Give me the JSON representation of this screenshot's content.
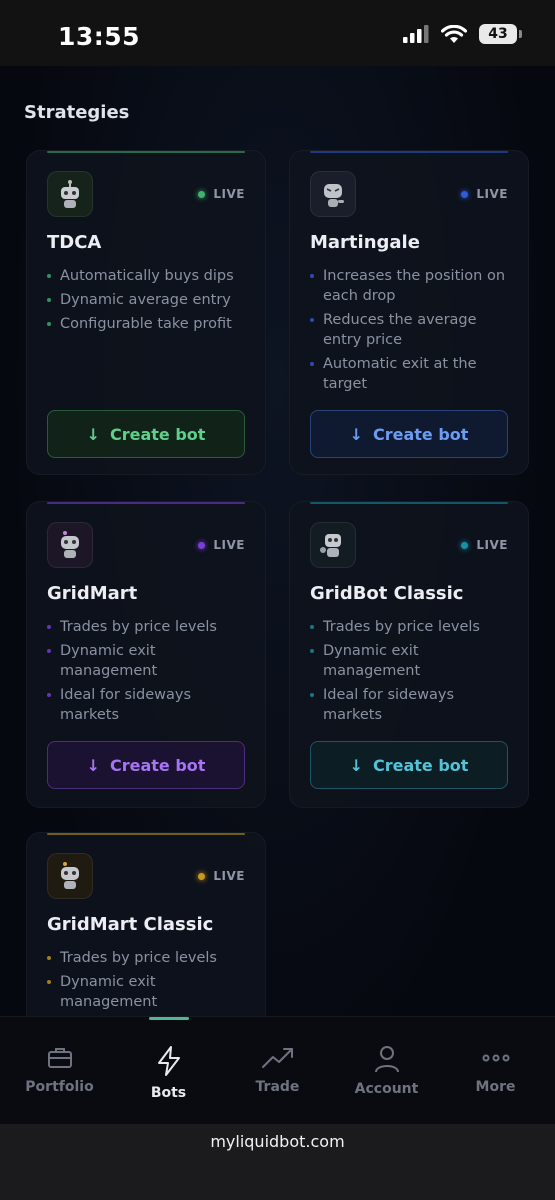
{
  "status_bar": {
    "time": "13:55",
    "battery": "43"
  },
  "page": {
    "section_title": "Strategies"
  },
  "strategies": [
    {
      "name": "TDCA",
      "status": "LIVE",
      "accent": "#3fb46d",
      "features": [
        "Automatically buys dips",
        "Dynamic average entry",
        "Configurable take profit"
      ],
      "button_label": "Create bot",
      "button_icon": "arrow-down-icon"
    },
    {
      "name": "Martingale",
      "status": "LIVE",
      "accent": "#2f5bd6",
      "features": [
        "Increases the position on each drop",
        "Reduces the average entry price",
        "Automatic exit at the target"
      ],
      "button_label": "Create bot",
      "button_icon": "arrow-down-icon"
    },
    {
      "name": "GridMart",
      "status": "LIVE",
      "accent": "#7b3fd9",
      "features": [
        "Trades by price levels",
        "Dynamic exit management",
        "Ideal for sideways markets"
      ],
      "button_label": "Create bot",
      "button_icon": "arrow-down-icon"
    },
    {
      "name": "GridBot Classic",
      "status": "LIVE",
      "accent": "#1a8fa8",
      "features": [
        "Trades by price levels",
        "Dynamic exit management",
        "Ideal for sideways markets"
      ],
      "button_label": "Create bot",
      "button_icon": "arrow-down-icon"
    },
    {
      "name": "GridMart Classic",
      "status": "LIVE",
      "accent": "#c99a1a",
      "features": [
        "Trades by price levels",
        "Dynamic exit management"
      ]
    }
  ],
  "tabs": [
    {
      "label": "Portfolio",
      "icon": "briefcase-icon"
    },
    {
      "label": "Bots",
      "icon": "lightning-icon",
      "active": true
    },
    {
      "label": "Trade",
      "icon": "trend-up-icon"
    },
    {
      "label": "Account",
      "icon": "user-icon"
    },
    {
      "label": "More",
      "icon": "more-dots-icon"
    }
  ],
  "browser": {
    "url": "myliquidbot.com"
  }
}
